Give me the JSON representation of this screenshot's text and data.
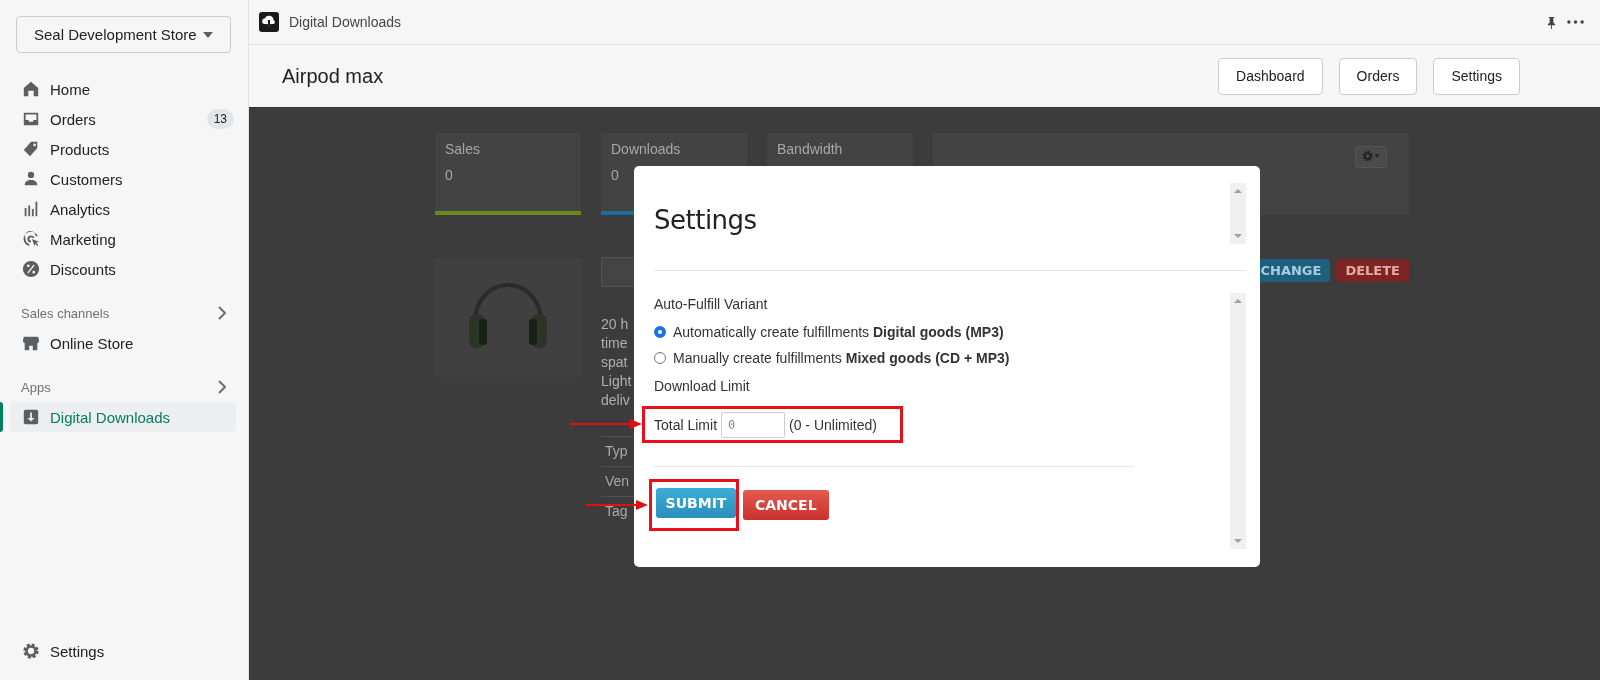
{
  "sidebar": {
    "store_selector": "Seal Development Store",
    "nav": [
      {
        "label": "Home",
        "selected": false
      },
      {
        "label": "Orders",
        "badge": "13",
        "selected": false
      },
      {
        "label": "Products",
        "selected": false
      },
      {
        "label": "Customers",
        "selected": false
      },
      {
        "label": "Analytics",
        "selected": false
      },
      {
        "label": "Marketing",
        "selected": false
      },
      {
        "label": "Discounts",
        "selected": false
      }
    ],
    "sections": [
      {
        "title": "Sales channels",
        "items": [
          {
            "label": "Online Store",
            "selected": false
          }
        ]
      },
      {
        "title": "Apps",
        "items": [
          {
            "label": "Digital Downloads",
            "selected": true
          }
        ]
      }
    ],
    "settings": "Settings"
  },
  "topbar": {
    "app_title": "Digital Downloads",
    "page_title": "Airpod max",
    "buttons": [
      "Dashboard",
      "Orders",
      "Settings"
    ]
  },
  "background": {
    "stats": [
      {
        "label": "Sales",
        "value": "0",
        "color": "#6b8a1e"
      },
      {
        "label": "Downloads",
        "value": "0",
        "color": "#1f6c9c"
      },
      {
        "label": "Bandwidth"
      }
    ],
    "description_lines": [
      "20 h",
      "time",
      "spat",
      "Light",
      "deliv"
    ],
    "table_rows": [
      "Typ",
      "Ven",
      "Tag"
    ],
    "variant_buttons": [
      {
        "label": "CHANGE",
        "kind": "primary"
      },
      {
        "label": "DELETE",
        "kind": "danger"
      }
    ]
  },
  "modal": {
    "title": "Settings",
    "fulfill_label": "Auto-Fulfill Variant",
    "options": [
      {
        "text": "Automatically create fulfillments **Digital goods (MP3)**",
        "selected": true
      },
      {
        "text": "Manually create fulfillments **Mixed goods (CD + MP3)**",
        "selected": false
      }
    ],
    "limit_label": "Download Limit",
    "total_label": "Total Limit",
    "total_placeholder": "0",
    "limit_hint": "(0 - Unlimited)",
    "buttons": [
      {
        "label": "SUBMIT",
        "kind": "primary"
      },
      {
        "label": "CANCEL",
        "kind": "danger"
      }
    ]
  }
}
